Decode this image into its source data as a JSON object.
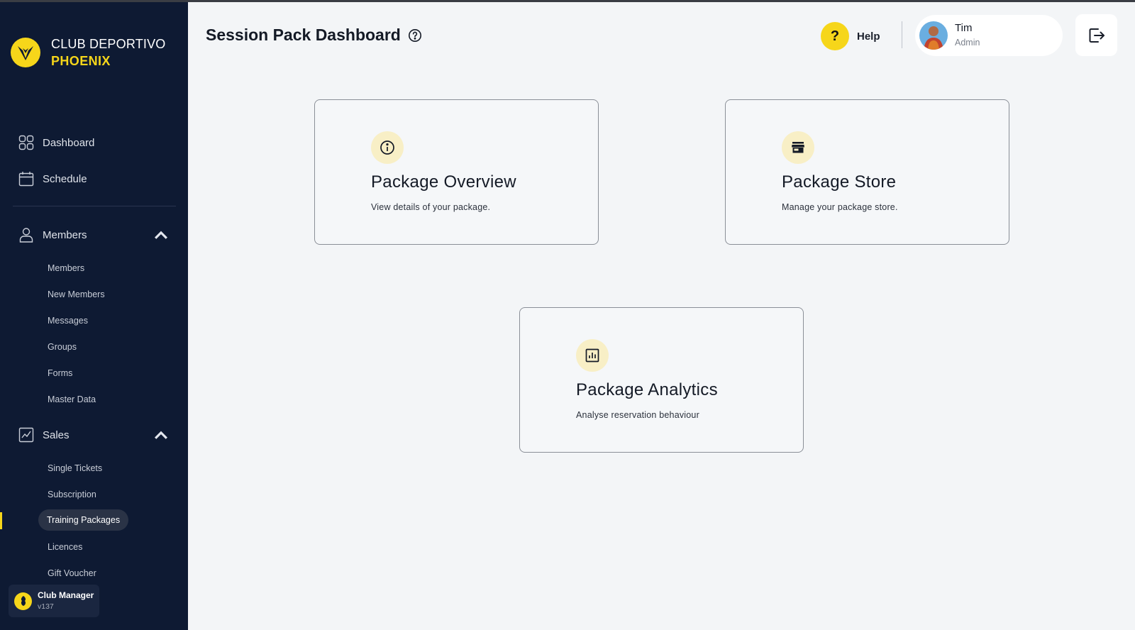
{
  "brand": {
    "line1": "CLUB DEPORTIVO",
    "line2": "PHOENIX"
  },
  "sidebar": {
    "main_items": [
      {
        "label": "Dashboard",
        "icon": "dashboard-grid-icon"
      },
      {
        "label": "Schedule",
        "icon": "calendar-icon"
      }
    ],
    "members": {
      "label": "Members",
      "icon": "user-icon",
      "items": [
        "Members",
        "New Members",
        "Messages",
        "Groups",
        "Forms",
        "Master Data"
      ]
    },
    "sales": {
      "label": "Sales",
      "icon": "chart-line-icon",
      "items": [
        "Single Tickets",
        "Subscription",
        "Training Packages",
        "Licences",
        "Gift Voucher"
      ],
      "active": "Training Packages"
    },
    "app_card": {
      "name": "Club Manager",
      "version": "v137"
    }
  },
  "header": {
    "title": "Session Pack Dashboard",
    "help_symbol": "?",
    "help_label": "Help",
    "user": {
      "name": "Tim",
      "role": "Admin"
    }
  },
  "cards": [
    {
      "title": "Package Overview",
      "description": "View details of your package.",
      "icon": "info-icon"
    },
    {
      "title": "Package Store",
      "description": "Manage your package store.",
      "icon": "store-icon"
    },
    {
      "title": "Package Analytics",
      "description": "Analyse reservation behaviour",
      "icon": "analytics-icon"
    }
  ],
  "colors": {
    "sidebar_bg": "#0e1a33",
    "accent": "#f6d61a",
    "page_bg": "#f3f5f7",
    "card_icon_bg": "#f8efc6"
  }
}
